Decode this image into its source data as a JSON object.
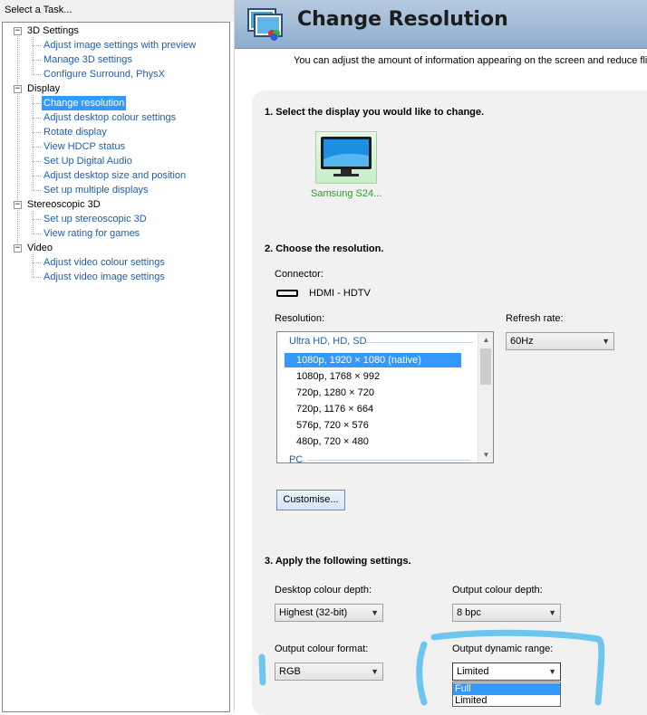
{
  "task_pane": {
    "header": "Select a Task...",
    "categories": [
      {
        "label": "3D Settings",
        "items": [
          "Adjust image settings with preview",
          "Manage 3D settings",
          "Configure Surround, PhysX"
        ]
      },
      {
        "label": "Display",
        "items": [
          "Change resolution",
          "Adjust desktop colour settings",
          "Rotate display",
          "View HDCP status",
          "Set Up Digital Audio",
          "Adjust desktop size and position",
          "Set up multiple displays"
        ]
      },
      {
        "label": "Stereoscopic 3D",
        "items": [
          "Set up stereoscopic 3D",
          "View rating for games"
        ]
      },
      {
        "label": "Video",
        "items": [
          "Adjust video colour settings",
          "Adjust video image settings"
        ]
      }
    ],
    "selected_item": "Change resolution",
    "expander_symbol": "−"
  },
  "page": {
    "title": "Change Resolution",
    "description": "You can adjust the amount of information appearing on the screen and reduce flicke"
  },
  "section1": {
    "title": "1. Select the display you would like to change.",
    "display_name": "Samsung S24..."
  },
  "section2": {
    "title": "2. Choose the resolution.",
    "connector_label": "Connector:",
    "connector_value": "HDMI - HDTV",
    "resolution_label": "Resolution:",
    "refresh_label": "Refresh rate:",
    "refresh_value": "60Hz",
    "list_group": "Ultra HD, HD, SD",
    "resolutions": [
      "1080p, 1920 × 1080 (native)",
      "1080p, 1768 × 992",
      "720p, 1280 × 720",
      "720p, 1176 × 664",
      "576p, 720 × 576",
      "480p, 720 × 480"
    ],
    "selected_resolution": "1080p, 1920 × 1080 (native)",
    "next_group": "PC",
    "customise_button": "Customise..."
  },
  "section3": {
    "title": "3. Apply the following settings.",
    "desktop_depth_label": "Desktop colour depth:",
    "desktop_depth_value": "Highest (32-bit)",
    "output_depth_label": "Output colour depth:",
    "output_depth_value": "8 bpc",
    "output_format_label": "Output colour format:",
    "output_format_value": "RGB",
    "dynamic_range_label": "Output dynamic range:",
    "dynamic_range_value": "Limited",
    "dynamic_range_options": [
      "Full",
      "Limited"
    ],
    "highlighted_option": "Full"
  },
  "colors": {
    "accent": "#3399ff",
    "link": "#1f5fa8",
    "banner": "#9fb9d6",
    "annotation": "#6ec6ee"
  },
  "icons": [
    "nvidia-control-panel-icon",
    "monitor-icon",
    "hdmi-connector-icon",
    "dropdown-arrow-icon",
    "scroll-up-icon",
    "scroll-down-icon"
  ]
}
